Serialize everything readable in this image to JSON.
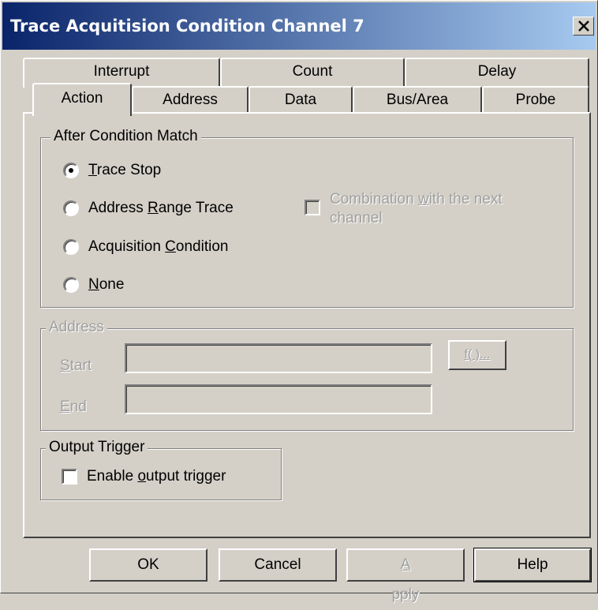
{
  "window": {
    "title": "Trace Acquitision Condition Channel 7",
    "close_label": "X"
  },
  "tabs": {
    "row1": [
      "Interrupt",
      "Count",
      "Delay"
    ],
    "row2": [
      "Action",
      "Address",
      "Data",
      "Bus/Area",
      "Probe"
    ],
    "selected": "Action"
  },
  "after_condition": {
    "legend": "After Condition Match",
    "options": [
      {
        "pre": "",
        "u": "T",
        "post": "race Stop",
        "checked": true
      },
      {
        "pre": "Address ",
        "u": "R",
        "post": "ange Trace",
        "checked": false
      },
      {
        "pre": "Acquisition ",
        "u": "C",
        "post": "ondition",
        "checked": false
      },
      {
        "pre": "",
        "u": "N",
        "post": "one",
        "checked": false
      }
    ],
    "combination": {
      "pre": "Combination ",
      "u": "w",
      "post": "ith the next",
      "line2": "channel",
      "checked": false,
      "enabled": false
    }
  },
  "address": {
    "legend": "Address",
    "start_u": "S",
    "start_post": "tart",
    "end_u": "E",
    "end_post": "nd",
    "start_value": "",
    "end_value": "",
    "func_button": "f( )..."
  },
  "output_trigger": {
    "legend": "Output Trigger",
    "pre": "Enable ",
    "u": "o",
    "post": "utput trigger",
    "checked": false
  },
  "buttons": {
    "ok": "OK",
    "cancel": "Cancel",
    "apply_u": "A",
    "apply_post": "pply",
    "help": "Help"
  }
}
